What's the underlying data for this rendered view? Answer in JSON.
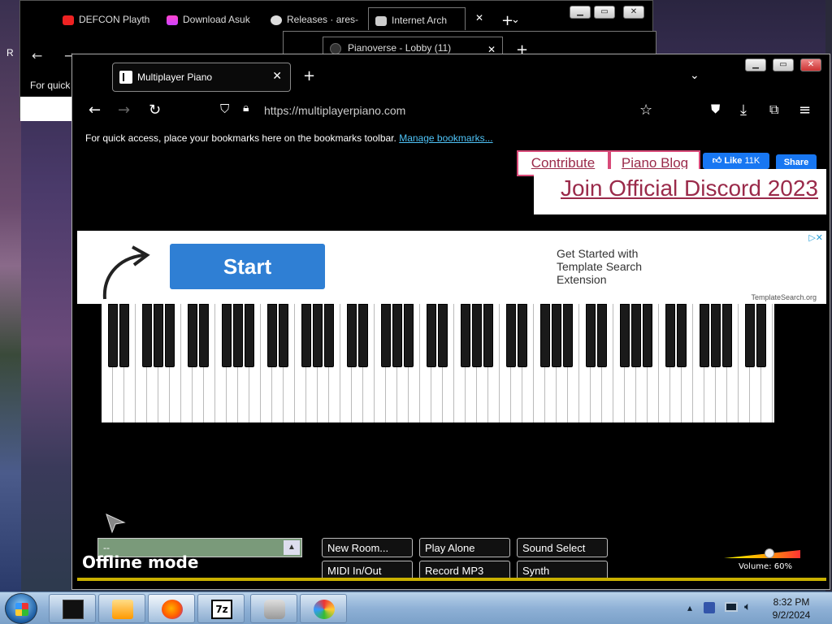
{
  "desktop": {
    "edge_letter": "R"
  },
  "back_window_1": {
    "tabs": [
      {
        "label": "DEFCON Playth"
      },
      {
        "label": "Download Asuk"
      },
      {
        "label": "Releases · ares-"
      },
      {
        "label": "Internet Arch"
      }
    ],
    "bookmarks_text": "For quick"
  },
  "back_window_2": {
    "tab_label": "Pianoverse - Lobby (11)"
  },
  "browser": {
    "tab_title": "Multiplayer Piano",
    "url": "https://multiplayerpiano.com",
    "bookmarks_bar_text": "For quick access, place your bookmarks here on the bookmarks toolbar.",
    "bookmarks_link": "Manage bookmarks..."
  },
  "page": {
    "contribute": "Contribute",
    "piano_blog": "Piano Blog",
    "fb_like": "Like",
    "fb_like_count": "11K",
    "fb_share": "Share",
    "discord": "Join Official Discord 2023",
    "ad": {
      "button": "Start",
      "text": "Get Started with Template Search Extension",
      "source": "TemplateSearch.org"
    },
    "chat_value": "--",
    "offline": "Offline mode",
    "buttons": [
      "New Room...",
      "Play Alone",
      "Sound Select",
      "MIDI In/Out",
      "Record MP3",
      "Synth"
    ],
    "volume_label": "Volume: 60%",
    "volume_level": 0.6
  },
  "taskbar": {
    "time": "8:32 PM",
    "date": "9/2/2024",
    "apps": [
      "terminal",
      "media-player",
      "firefox",
      "7zip",
      "game-controller",
      "paint"
    ]
  }
}
